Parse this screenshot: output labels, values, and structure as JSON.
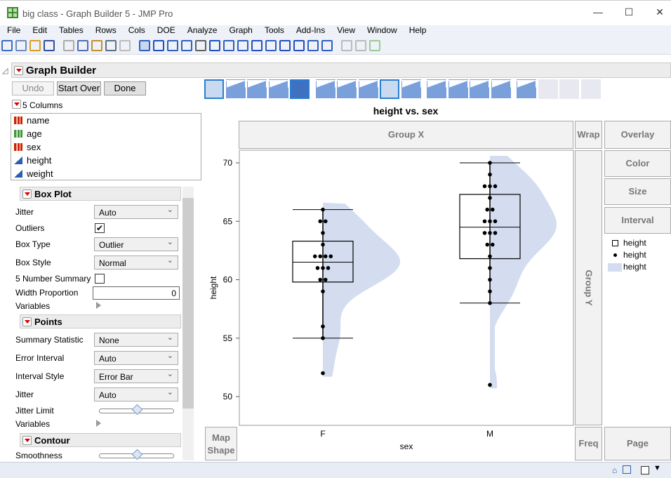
{
  "window": {
    "title": "big class - Graph Builder 5 - JMP Pro",
    "minimize": "—",
    "maximize": "☐",
    "close": "✕"
  },
  "menu": [
    "File",
    "Edit",
    "Tables",
    "Rows",
    "Cols",
    "DOE",
    "Analyze",
    "Graph",
    "Tools",
    "Add-Ins",
    "View",
    "Window",
    "Help"
  ],
  "toolbar_icons": [
    "new-data-table-icon",
    "new-script-icon",
    "open-icon",
    "save-icon",
    "cut-icon",
    "copy-icon",
    "paste-icon",
    "data-filter-icon",
    "lock-icon",
    "arrow-icon",
    "help-icon",
    "selection-icon",
    "crosshair-target-icon",
    "hand-icon",
    "brush-icon",
    "lasso-icon",
    "magnifier-icon",
    "crosshair-icon",
    "line-icon",
    "annotate-icon",
    "arrow-line-icon",
    "polygon-icon",
    "ellipse-icon",
    "report-icon",
    "journal-icon",
    "add-icon"
  ],
  "graph_builder": {
    "title": "Graph Builder",
    "undo": "Undo",
    "start_over": "Start Over",
    "done": "Done"
  },
  "columns": {
    "header": "5 Columns",
    "items": [
      {
        "name": "name",
        "type": "nominal"
      },
      {
        "name": "age",
        "type": "ordinal"
      },
      {
        "name": "sex",
        "type": "nominal"
      },
      {
        "name": "height",
        "type": "continuous"
      },
      {
        "name": "weight",
        "type": "continuous"
      }
    ]
  },
  "box_plot": {
    "title": "Box Plot",
    "jitter_label": "Jitter",
    "jitter": "Auto",
    "outliers_label": "Outliers",
    "outliers": true,
    "box_type_label": "Box Type",
    "box_type": "Outlier",
    "box_style_label": "Box Style",
    "box_style": "Normal",
    "five_num_label": "5 Number Summary",
    "five_num": false,
    "width_prop_label": "Width Proportion",
    "width_prop": "0",
    "variables_label": "Variables"
  },
  "points": {
    "title": "Points",
    "summary_label": "Summary Statistic",
    "summary": "None",
    "error_label": "Error Interval",
    "error": "Auto",
    "interval_label": "Interval Style",
    "interval": "Error Bar",
    "jitter_label": "Jitter",
    "jitter": "Auto",
    "jitter_limit_label": "Jitter Limit",
    "jitter_limit": 0.5,
    "variables_label": "Variables"
  },
  "contour": {
    "title": "Contour",
    "smoothness_label": "Smoothness",
    "smoothness": 0.5
  },
  "graph_types": [
    "points",
    "smoother",
    "line-of-fit",
    "ellipse",
    "contour",
    "line",
    "bar",
    "area",
    "box-plot",
    "histogram",
    "heatmap",
    "pie",
    "treemap",
    "mosaic",
    "caption-box",
    "formula",
    "map-shapes",
    "parallel-plot"
  ],
  "zones": {
    "group_x": "Group X",
    "wrap": "Wrap",
    "overlay": "Overlay",
    "color": "Color",
    "size": "Size",
    "interval": "Interval",
    "group_y": "Group Y",
    "map_shape": "Map Shape",
    "freq": "Freq",
    "page": "Page"
  },
  "legend": [
    {
      "symbol": "box",
      "label": "height"
    },
    {
      "symbol": "dot",
      "label": "height"
    },
    {
      "symbol": "violin",
      "label": "height"
    }
  ],
  "colors": {
    "violin": "#d4ddf0",
    "accent": "#2a5fb0",
    "nominal": "#cc2200",
    "ordinal": "#3c9a3c"
  },
  "chart_data": {
    "type": "box",
    "title": "height vs. sex",
    "xlabel": "sex",
    "ylabel": "height",
    "categories": [
      "F",
      "M"
    ],
    "ylim": [
      49,
      71.2
    ],
    "yticks": [
      50,
      55,
      60,
      65,
      70
    ],
    "grid": false,
    "legend_position": "right",
    "points": {
      "F": [
        66,
        65,
        65,
        64,
        63,
        62,
        62,
        62,
        62,
        61,
        61,
        61,
        60,
        60,
        59,
        56,
        55,
        52
      ],
      "M": [
        70,
        69,
        68,
        68,
        68,
        67,
        66,
        66,
        65,
        65,
        65,
        64,
        64,
        64,
        63,
        63,
        62,
        61,
        60,
        59,
        58,
        51
      ]
    },
    "boxes": [
      {
        "category": "F",
        "whisker_low": 55,
        "q1": 59.8,
        "median": 61.5,
        "q3": 63.3,
        "whisker_high": 66
      },
      {
        "category": "M",
        "whisker_low": 58,
        "q1": 61.8,
        "median": 64.5,
        "q3": 67.3,
        "whisker_high": 70
      }
    ]
  }
}
